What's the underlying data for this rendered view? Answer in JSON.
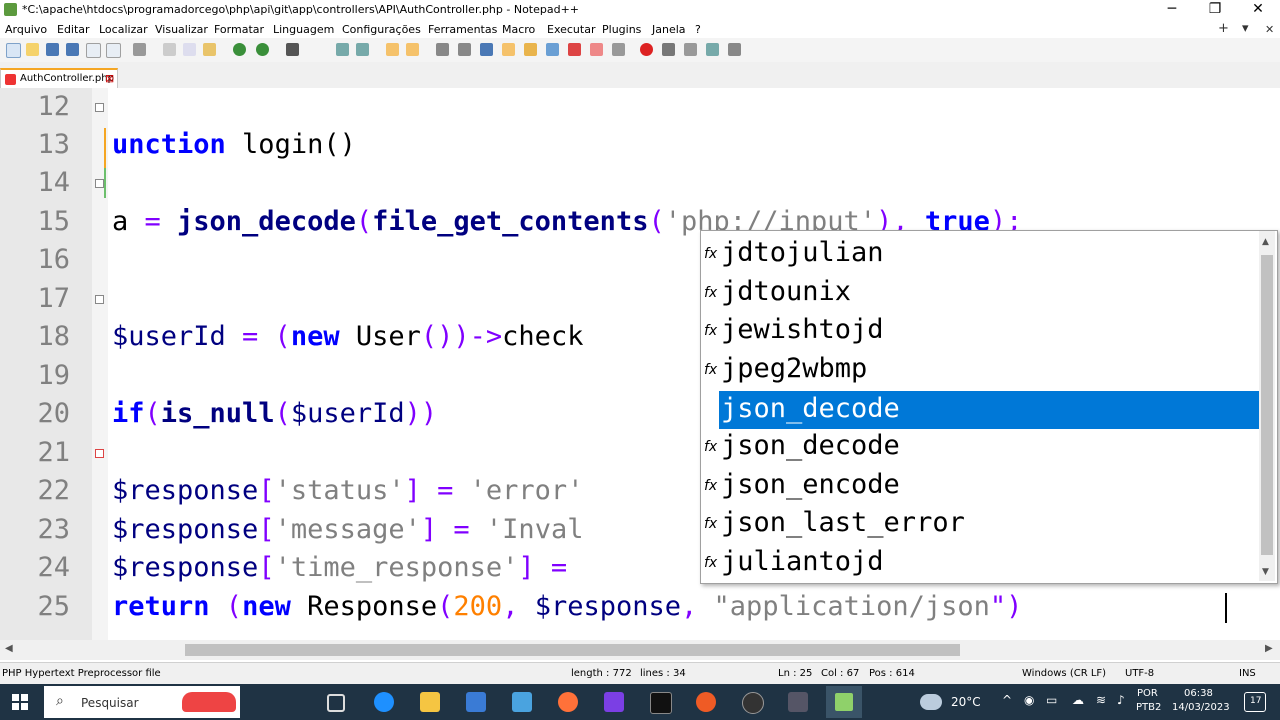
{
  "window": {
    "title": "*C:\\apache\\htdocs\\programadorcego\\php\\api\\git\\app\\controllers\\API\\AuthController.php - Notepad++",
    "minimize": "─",
    "maximize": "❐",
    "close": "✕"
  },
  "menu": {
    "items": [
      "Arquivo",
      "Editar",
      "Localizar",
      "Visualizar",
      "Formatar",
      "Linguagem",
      "Configurações",
      "Ferramentas",
      "Macro",
      "Executar",
      "Plugins",
      "Janela",
      "?"
    ],
    "add": "+",
    "list": "▾",
    "close": "✕"
  },
  "tab": {
    "label": "AuthController.php",
    "close": "⊠"
  },
  "editor": {
    "lines": [
      {
        "n": "12",
        "fold": true
      },
      {
        "n": "13",
        "fold": false
      },
      {
        "n": "14",
        "fold": true
      },
      {
        "n": "15",
        "fold": false
      },
      {
        "n": "16",
        "fold": false
      },
      {
        "n": "17",
        "fold": true
      },
      {
        "n": "18",
        "fold": false
      },
      {
        "n": "19",
        "fold": false
      },
      {
        "n": "20",
        "fold": false
      },
      {
        "n": "21",
        "fold": true
      },
      {
        "n": "22",
        "fold": false
      },
      {
        "n": "23",
        "fold": false
      },
      {
        "n": "24",
        "fold": false
      },
      {
        "n": "25",
        "fold": false
      }
    ],
    "code13": {
      "kw": "unction",
      "rest": " login()"
    },
    "code15": {
      "a": "a ",
      "eq": "= ",
      "f1": "json_decode",
      "p1": "(",
      "f2": "file_get_contents",
      "p2": "(",
      "s": "'php://input'",
      "p3": "), ",
      "t": "true",
      "p4": ");"
    },
    "code18": {
      "v": "$userId ",
      "eq": "= (",
      "kw": "new",
      "cls": " User",
      "p": "())->",
      "m": "check"
    },
    "code20": {
      "kw": "if",
      "p1": "(",
      "f": "is_null",
      "p2": "(",
      "v": "$userId",
      "p3": "))"
    },
    "code22": {
      "v": "$response",
      "p1": "[",
      "s": "'status'",
      "p2": "] = ",
      "s2": "'error'"
    },
    "code23": {
      "v": "$response",
      "p1": "[",
      "s": "'message'",
      "p2": "] = ",
      "s2": "'Inval"
    },
    "code24": {
      "v": "$response",
      "p1": "[",
      "s": "'time_response'",
      "p2": "] = "
    },
    "code25": {
      "kw": "return",
      "p1": " (",
      "kw2": "new",
      "cls": " Response",
      "p2": "(",
      "num": "200",
      "p3": ", ",
      "v": "$response",
      "p4": ", ",
      "s": "\"application/json",
      "p5": "\")"
    }
  },
  "autocomplete": {
    "icon": "fx",
    "items": [
      "jdtojulian",
      "jdtounix",
      "jewishtojd",
      "jpeg2wbmp",
      "json_decode",
      "json_decode",
      "json_encode",
      "json_last_error",
      "juliantojd"
    ],
    "selected_index": 4
  },
  "status": {
    "file_type": "PHP Hypertext Preprocessor file",
    "length": "length : 772",
    "lines": "lines : 34",
    "ln": "Ln : 25",
    "col": "Col : 67",
    "pos": "Pos : 614",
    "eol": "Windows (CR LF)",
    "encoding": "UTF-8",
    "mode": "INS"
  },
  "taskbar": {
    "search_placeholder": "Pesquisar",
    "weather": "20°C",
    "lang": "POR",
    "layout": "PTB2",
    "time": "06:38",
    "date": "14/03/2023",
    "notifications": "17"
  },
  "colors": {
    "selection": "#0078d7",
    "keyword": "#0000ff",
    "string": "#808080",
    "number": "#ff8000",
    "taskbar": "#1f3344"
  }
}
